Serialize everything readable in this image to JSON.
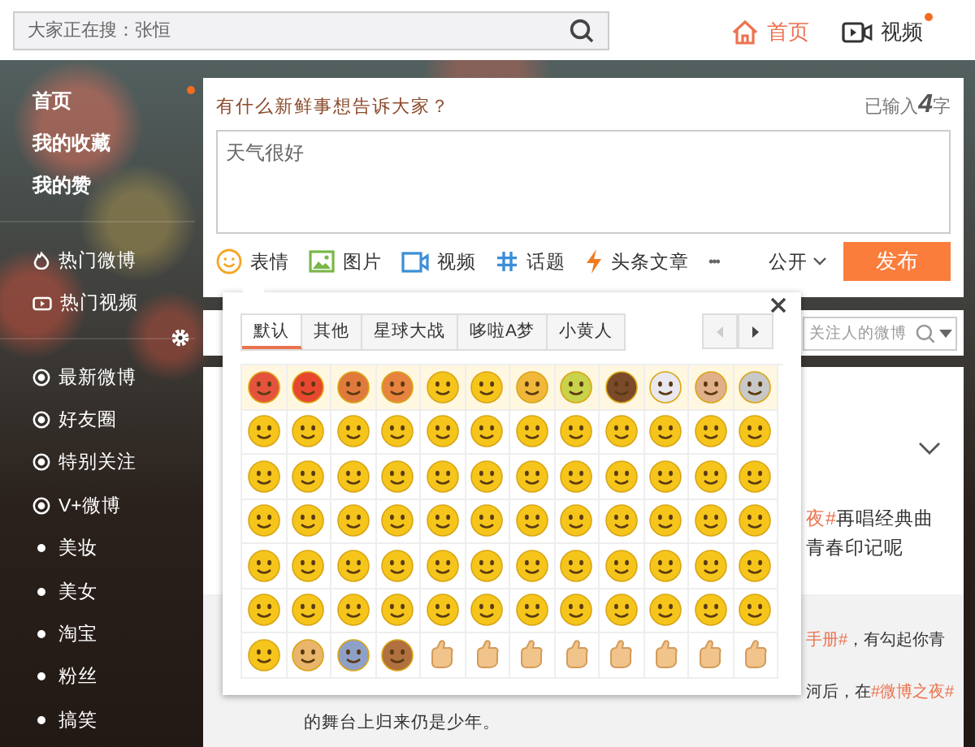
{
  "top_bar": {
    "search": {
      "placeholder": "大家正在搜：张恒"
    },
    "nav": [
      {
        "label": "首页",
        "selected": true,
        "dot": false
      },
      {
        "label": "视频",
        "selected": false,
        "dot": true
      }
    ]
  },
  "sidebar": {
    "sections": [
      {
        "items": [
          {
            "label": "首页",
            "dot": true
          },
          {
            "label": "我的收藏",
            "dot": false
          },
          {
            "label": "我的赞",
            "dot": false
          }
        ]
      },
      {
        "items": [
          {
            "label": "热门微博",
            "dot": false
          },
          {
            "label": "热门视频",
            "dot": false
          }
        ]
      },
      {
        "items": [
          {
            "label": "最新微博",
            "dot": false
          },
          {
            "label": "好友圈",
            "dot": false
          },
          {
            "label": "特别关注",
            "dot": false
          },
          {
            "label": "V+微博",
            "dot": false
          },
          {
            "label": "美妆",
            "dot": false
          },
          {
            "label": "美女",
            "dot": false
          },
          {
            "label": "淘宝",
            "dot": false
          },
          {
            "label": "粉丝",
            "dot": false
          },
          {
            "label": "搞笑",
            "dot": false
          }
        ]
      }
    ]
  },
  "composer": {
    "prompt": "有什么新鲜事想告诉大家？",
    "counter": {
      "prefix": "已输入",
      "count": "4",
      "suffix": "字"
    },
    "value": "天气很好",
    "tools": [
      "表情",
      "图片",
      "视频",
      "话题",
      "头条文章",
      "•••"
    ],
    "visibility": "公开",
    "submit": "发布"
  },
  "emoji_panel": {
    "tabs": [
      {
        "label": "默认",
        "selected": true
      },
      {
        "label": "其他",
        "selected": false
      },
      {
        "label": "星球大战",
        "selected": false
      },
      {
        "label": "哆啦A梦",
        "selected": false
      },
      {
        "label": "小黄人",
        "selected": false
      }
    ],
    "prev": {
      "disabled": true
    },
    "next": {
      "disabled": false
    }
  },
  "feed": {
    "filter": {
      "placeholder": "关注人的微博"
    },
    "posts": [
      {
        "highlighted": false,
        "tail_lines": [
          [
            {
              "text": "夜#",
              "link": true
            },
            {
              "text": "再唱经典曲",
              "link": false
            }
          ],
          [
            {
              "text": "青春印记呢",
              "link": false
            }
          ]
        ]
      },
      {
        "highlighted": true,
        "tail_lines": [
          [
            {
              "text": "手册#",
              "link": true
            },
            {
              "text": "，有勾起你青",
              "link": false
            }
          ],
          [
            {
              "text": "河后，在",
              "link": false
            },
            {
              "text": "#微博之夜#",
              "link": true
            }
          ]
        ],
        "lines": [
          "的舞台上归来仍是少年。"
        ]
      }
    ]
  }
}
